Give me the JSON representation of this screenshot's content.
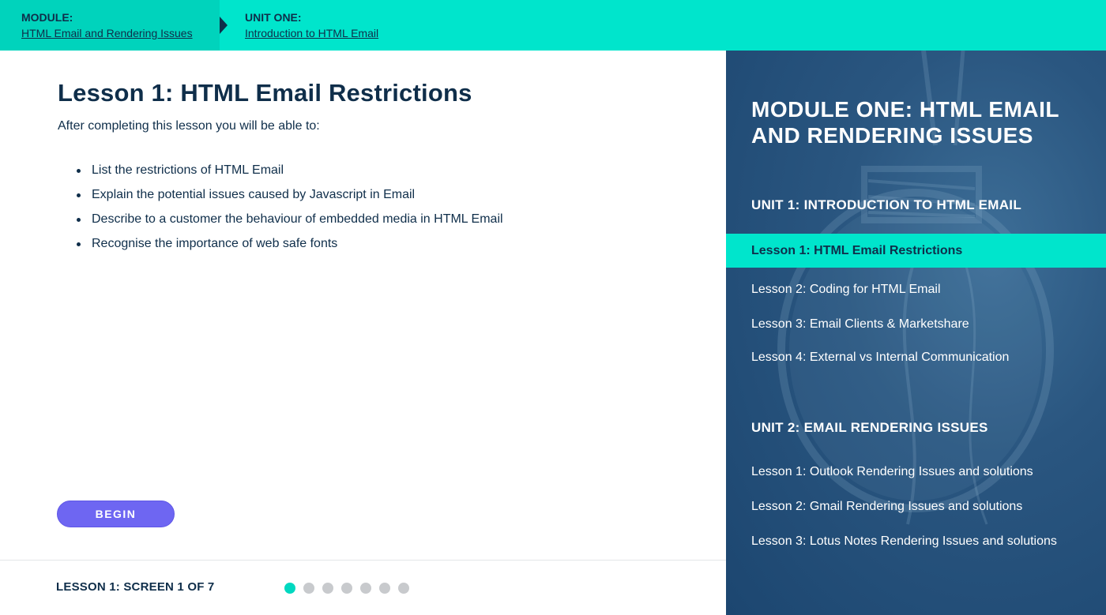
{
  "breadcrumb": {
    "module_label": "MODULE:",
    "module_link": "HTML Email and Rendering Issues",
    "unit_label": "UNIT ONE:",
    "unit_link": "Introduction to HTML Email"
  },
  "lesson": {
    "title": "Lesson 1: HTML Email Restrictions",
    "intro": "After completing this lesson you will be able to:",
    "objectives": [
      "List the restrictions of HTML Email",
      "Explain the potential issues caused by Javascript in Email",
      "Describe to a customer the behaviour of embedded media in HTML Email",
      "Recognise the importance of web safe fonts"
    ],
    "begin_label": "BEGIN"
  },
  "footer": {
    "screen_label": "LESSON 1: SCREEN 1 OF 7",
    "total_screens": 7,
    "current_screen": 1
  },
  "nav": {
    "module_title": "MODULE ONE: HTML EMAIL AND RENDERING ISSUES",
    "units": [
      {
        "title": "UNIT 1: INTRODUCTION TO HTML EMAIL",
        "lessons": [
          "Lesson 1: HTML Email Restrictions",
          "Lesson 2: Coding for HTML Email",
          "Lesson 3: Email Clients & Marketshare",
          "Lesson 4: External vs Internal Communication"
        ]
      },
      {
        "title": "UNIT 2: EMAIL RENDERING ISSUES",
        "lessons": [
          "Lesson 1: Outlook Rendering Issues and solutions",
          "Lesson 2: Gmail Rendering Issues and solutions",
          "Lesson 3: Lotus Notes Rendering Issues and solutions"
        ]
      }
    ]
  },
  "colors": {
    "accent": "#00e5cc",
    "navy": "#0f2e4a",
    "button": "#6e66f2",
    "panel": "#2a5680",
    "dot_inactive": "#c8cacd"
  }
}
